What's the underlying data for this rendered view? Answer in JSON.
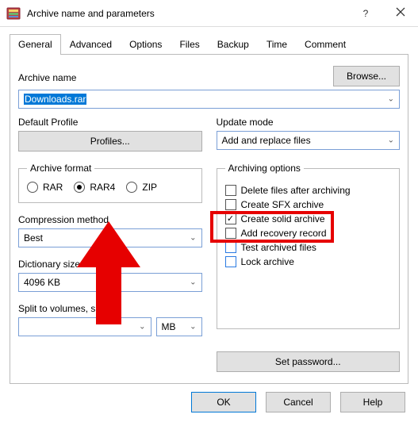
{
  "window": {
    "title": "Archive name and parameters"
  },
  "tabs": {
    "general": "General",
    "advanced": "Advanced",
    "options": "Options",
    "files": "Files",
    "backup": "Backup",
    "time": "Time",
    "comment": "Comment"
  },
  "archive_name": {
    "label": "Archive name",
    "value": "Downloads.rar",
    "browse": "Browse..."
  },
  "default_profile": {
    "label": "Default Profile",
    "button": "Profiles..."
  },
  "update_mode": {
    "label": "Update mode",
    "value": "Add and replace files"
  },
  "archive_format": {
    "legend": "Archive format",
    "rar": "RAR",
    "rar4": "RAR4",
    "zip": "ZIP",
    "selected": "rar4"
  },
  "archiving_options": {
    "legend": "Archiving options",
    "delete": "Delete files after archiving",
    "sfx": "Create SFX archive",
    "solid": "Create solid archive",
    "recovery": "Add recovery record",
    "test": "Test archived files",
    "lock": "Lock archive"
  },
  "compression": {
    "label": "Compression method",
    "value": "Best"
  },
  "dictionary": {
    "label": "Dictionary size",
    "value": "4096 KB"
  },
  "split": {
    "label": "Split to volumes, size",
    "value": "",
    "unit": "MB"
  },
  "set_password": "Set password...",
  "footer": {
    "ok": "OK",
    "cancel": "Cancel",
    "help": "Help"
  }
}
